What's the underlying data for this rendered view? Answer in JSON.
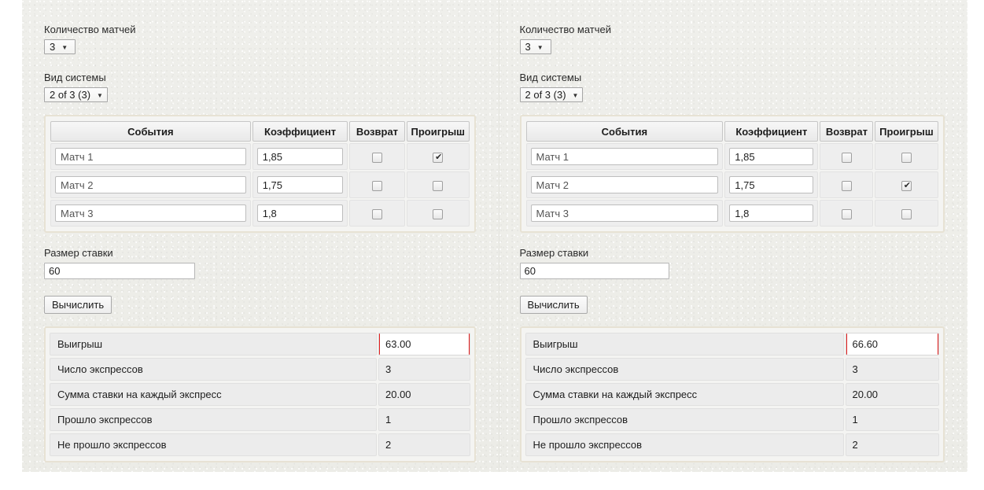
{
  "colors": {
    "highlight_border": "#e21b1b",
    "panel_bg": "#eeeeea",
    "card_border": "#e7e2d4"
  },
  "panels": [
    {
      "id": "left",
      "match_count": {
        "label": "Количество матчей",
        "value": "3",
        "caret": "▼"
      },
      "system_type": {
        "label": "Вид системы",
        "value": "2 of 3 (3)",
        "caret": "▼"
      },
      "matches_table": {
        "headers": [
          "События",
          "Коэффициент",
          "Возврат",
          "Проигрыш"
        ],
        "rows": [
          {
            "event": "Матч 1",
            "coefficient": "1,85",
            "returned": false,
            "lost": true
          },
          {
            "event": "Матч 2",
            "coefficient": "1,75",
            "returned": false,
            "lost": false
          },
          {
            "event": "Матч 3",
            "coefficient": "1,8",
            "returned": false,
            "lost": false
          }
        ]
      },
      "stake": {
        "label": "Размер ставки",
        "value": "60"
      },
      "calculate_button": "Вычислить",
      "results": {
        "rows": [
          {
            "label": "Выигрыш",
            "value": "63.00",
            "highlighted": true
          },
          {
            "label": "Число экспрессов",
            "value": "3",
            "highlighted": false
          },
          {
            "label": "Сумма ставки на каждый экспресс",
            "value": "20.00",
            "highlighted": false
          },
          {
            "label": "Прошло экспрессов",
            "value": "1",
            "highlighted": false
          },
          {
            "label": "Не прошло экспрессов",
            "value": "2",
            "highlighted": false
          }
        ]
      }
    },
    {
      "id": "right",
      "match_count": {
        "label": "Количество матчей",
        "value": "3",
        "caret": "▼"
      },
      "system_type": {
        "label": "Вид системы",
        "value": "2 of 3 (3)",
        "caret": "▼"
      },
      "matches_table": {
        "headers": [
          "События",
          "Коэффициент",
          "Возврат",
          "Проигрыш"
        ],
        "rows": [
          {
            "event": "Матч 1",
            "coefficient": "1,85",
            "returned": false,
            "lost": false
          },
          {
            "event": "Матч 2",
            "coefficient": "1,75",
            "returned": false,
            "lost": true
          },
          {
            "event": "Матч 3",
            "coefficient": "1,8",
            "returned": false,
            "lost": false
          }
        ]
      },
      "stake": {
        "label": "Размер ставки",
        "value": "60"
      },
      "calculate_button": "Вычислить",
      "results": {
        "rows": [
          {
            "label": "Выигрыш",
            "value": "66.60",
            "highlighted": true
          },
          {
            "label": "Число экспрессов",
            "value": "3",
            "highlighted": false
          },
          {
            "label": "Сумма ставки на каждый экспресс",
            "value": "20.00",
            "highlighted": false
          },
          {
            "label": "Прошло экспрессов",
            "value": "1",
            "highlighted": false
          },
          {
            "label": "Не прошло экспрессов",
            "value": "2",
            "highlighted": false
          }
        ]
      }
    }
  ]
}
